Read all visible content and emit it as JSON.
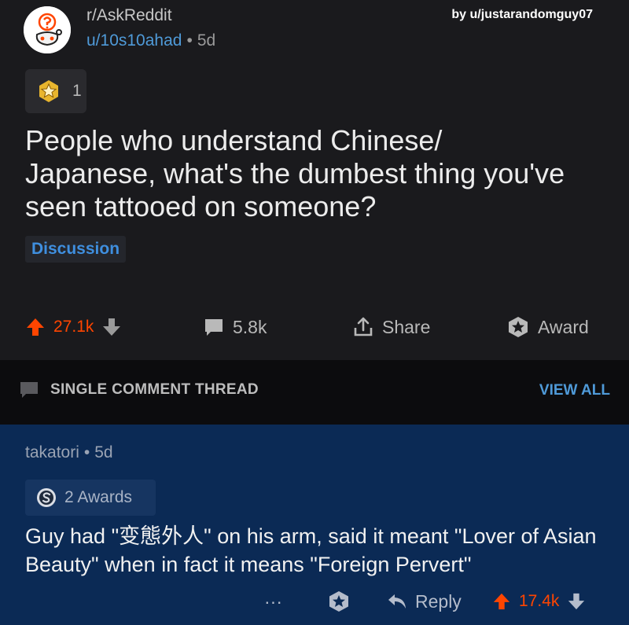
{
  "post": {
    "subreddit": "r/AskReddit",
    "author": "u/10s10ahad",
    "separator": "•",
    "age": "5d",
    "credit": "by u/justarandomguy07",
    "award_count": "1",
    "title": "People who understand Chinese/ Japanese, what's the dumbest thing you've seen tattooed on someone?",
    "flair": "Discussion",
    "score": "27.1k",
    "comments": "5.8k",
    "share_label": "Share",
    "award_label": "Award"
  },
  "thread": {
    "label": "SINGLE COMMENT THREAD",
    "view_all": "VIEW ALL"
  },
  "comment": {
    "author": "takatori",
    "separator": "•",
    "age": "5d",
    "awards": "2 Awards",
    "body": "Guy had \"变態外人\" on his arm, said it meant \"Lover of Asian Beauty\" when in fact it means \"Foreign Pervert\"",
    "more": "···",
    "reply_label": "Reply",
    "score": "17.4k"
  },
  "colors": {
    "upvote": "#ff4500",
    "link_blue": "#4f9ad8",
    "comment_bg": "#0b2a55",
    "post_bg": "#1a1a1d"
  },
  "icons": [
    "subreddit-avatar-icon",
    "award-star-icon",
    "upvote-icon",
    "downvote-icon",
    "comment-icon",
    "share-icon",
    "award-icon",
    "silver-award-icon",
    "more-icon",
    "reply-icon"
  ]
}
